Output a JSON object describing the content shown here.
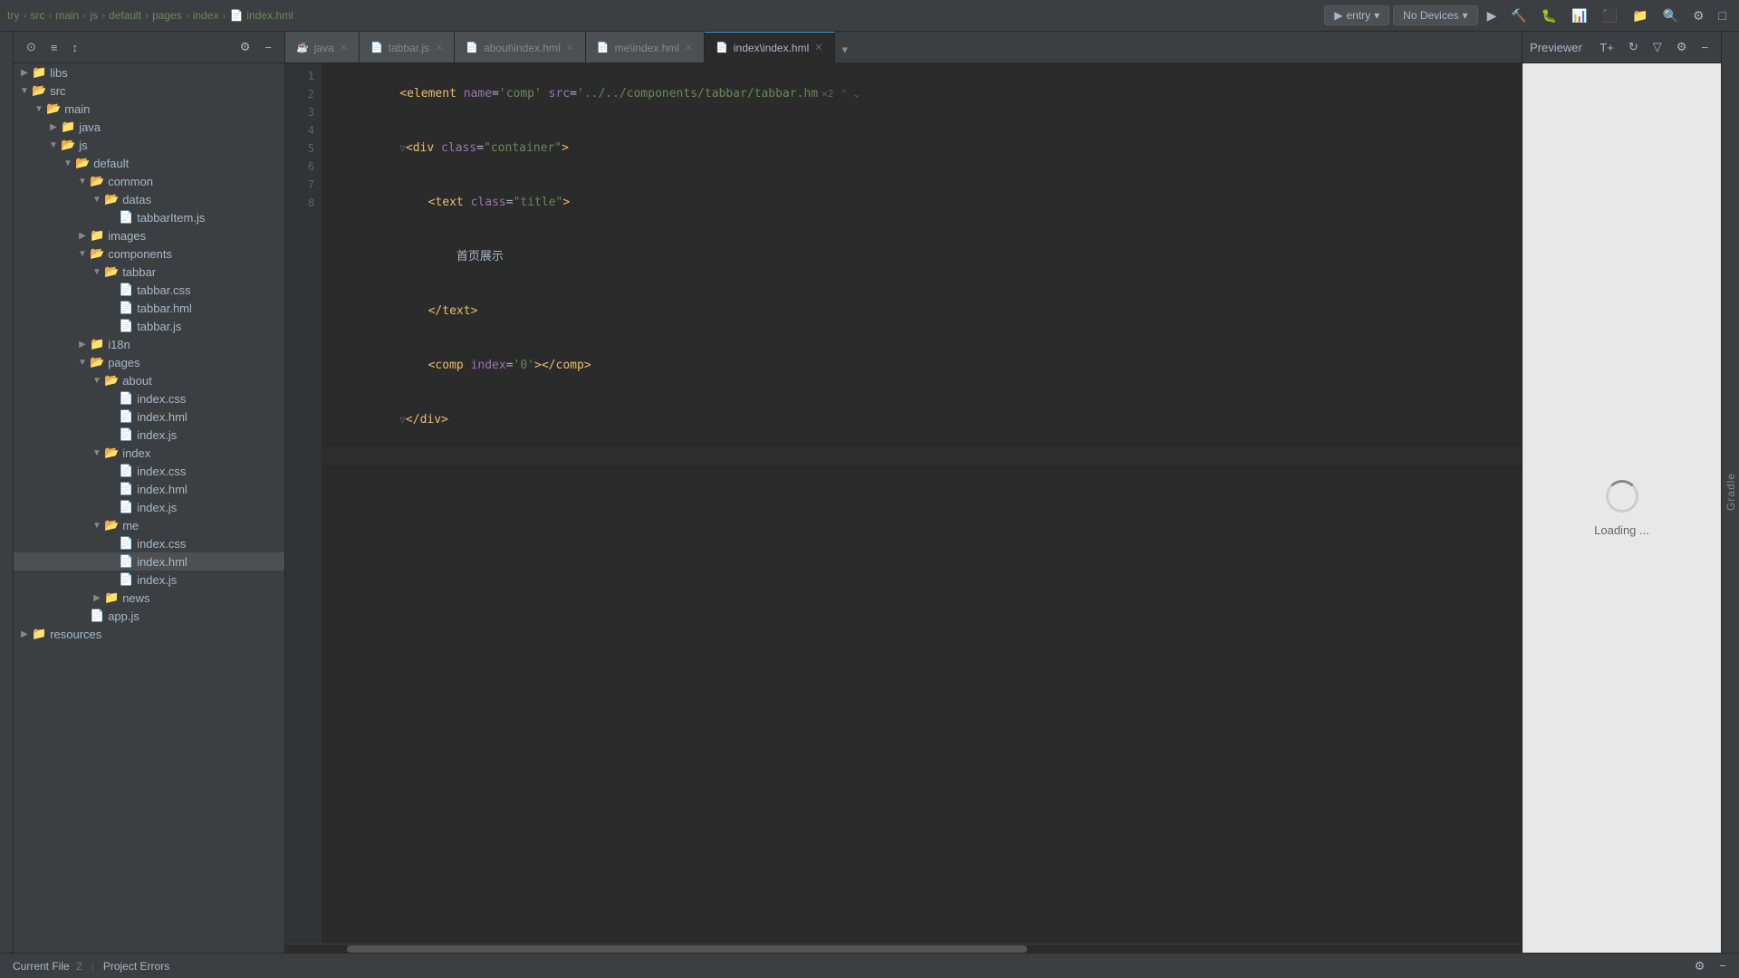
{
  "topbar": {
    "breadcrumb": [
      "try",
      "src",
      "main",
      "js",
      "default",
      "pages",
      "index",
      "index.hml"
    ],
    "entry_dropdown": "entry",
    "no_devices": "No Devices",
    "run_label": "Run",
    "build_label": "Build"
  },
  "editor_toolbar": {
    "icons": [
      "target",
      "align",
      "sort",
      "settings",
      "minus"
    ]
  },
  "tabs": [
    {
      "label": "java",
      "icon": "☕",
      "active": false,
      "closable": true
    },
    {
      "label": "tabbar.js",
      "icon": "JS",
      "active": false,
      "closable": true
    },
    {
      "label": "about\\index.hml",
      "icon": "H",
      "active": false,
      "closable": true
    },
    {
      "label": "me\\index.hml",
      "icon": "H",
      "active": false,
      "closable": true
    },
    {
      "label": "index\\index.hml",
      "icon": "H",
      "active": true,
      "closable": true
    }
  ],
  "previewer": {
    "title": "Previewer",
    "loading_text": "Loading ..."
  },
  "gradle": {
    "label": "Gradle"
  },
  "code": {
    "lines": [
      {
        "num": 1,
        "content": "<element name='comp' src='../../components/tabbar/tabbar.hm",
        "has_fold": true,
        "fold_count": "2",
        "highlighted": false
      },
      {
        "num": 2,
        "content": "<div class=\"container\">",
        "highlighted": false,
        "fold_arrow": true
      },
      {
        "num": 3,
        "content": "    <text class=\"title\">",
        "highlighted": false
      },
      {
        "num": 4,
        "content": "        首页展示",
        "highlighted": false
      },
      {
        "num": 5,
        "content": "    </text>",
        "highlighted": false
      },
      {
        "num": 6,
        "content": "    <comp index='0'></comp>",
        "highlighted": false
      },
      {
        "num": 7,
        "content": "</div>",
        "highlighted": false,
        "fold_arrow": true
      },
      {
        "num": 8,
        "content": "",
        "highlighted": true
      }
    ]
  },
  "sidebar": {
    "items": [
      {
        "label": "libs",
        "type": "folder",
        "depth": 0,
        "open": false
      },
      {
        "label": "src",
        "type": "folder",
        "depth": 0,
        "open": true
      },
      {
        "label": "main",
        "type": "folder",
        "depth": 1,
        "open": true
      },
      {
        "label": "java",
        "type": "folder",
        "depth": 2,
        "open": false
      },
      {
        "label": "js",
        "type": "folder",
        "depth": 2,
        "open": true
      },
      {
        "label": "default",
        "type": "folder",
        "depth": 3,
        "open": true
      },
      {
        "label": "common",
        "type": "folder",
        "depth": 4,
        "open": true
      },
      {
        "label": "datas",
        "type": "folder",
        "depth": 5,
        "open": true
      },
      {
        "label": "tabbarItem.js",
        "type": "js",
        "depth": 6
      },
      {
        "label": "images",
        "type": "folder",
        "depth": 4,
        "open": false
      },
      {
        "label": "components",
        "type": "folder",
        "depth": 4,
        "open": true
      },
      {
        "label": "tabbar",
        "type": "folder",
        "depth": 5,
        "open": true
      },
      {
        "label": "tabbar.css",
        "type": "css",
        "depth": 6
      },
      {
        "label": "tabbar.hml",
        "type": "hml",
        "depth": 6
      },
      {
        "label": "tabbar.js",
        "type": "js",
        "depth": 6
      },
      {
        "label": "i18n",
        "type": "folder",
        "depth": 4,
        "open": false
      },
      {
        "label": "pages",
        "type": "folder",
        "depth": 4,
        "open": true
      },
      {
        "label": "about",
        "type": "folder",
        "depth": 5,
        "open": true
      },
      {
        "label": "index.css",
        "type": "css",
        "depth": 6
      },
      {
        "label": "index.hml",
        "type": "hml",
        "depth": 6
      },
      {
        "label": "index.js",
        "type": "js",
        "depth": 6
      },
      {
        "label": "index",
        "type": "folder",
        "depth": 5,
        "open": true
      },
      {
        "label": "index.css",
        "type": "css",
        "depth": 6
      },
      {
        "label": "index.hml",
        "type": "hml",
        "depth": 6
      },
      {
        "label": "index.js",
        "type": "js",
        "depth": 6
      },
      {
        "label": "me",
        "type": "folder",
        "depth": 5,
        "open": true
      },
      {
        "label": "index.css",
        "type": "css",
        "depth": 6
      },
      {
        "label": "index.hml",
        "type": "hml",
        "depth": 6,
        "selected": true
      },
      {
        "label": "index.js",
        "type": "js",
        "depth": 6
      },
      {
        "label": "news",
        "type": "folder",
        "depth": 5,
        "open": false
      },
      {
        "label": "app.js",
        "type": "js",
        "depth": 4
      },
      {
        "label": "resources",
        "type": "folder",
        "depth": 0,
        "open": false
      }
    ]
  },
  "statusbar": {
    "current_file": "Current File",
    "number": "2",
    "project_errors": "Project Errors",
    "gear_icon": "⚙",
    "minus_icon": "−"
  }
}
